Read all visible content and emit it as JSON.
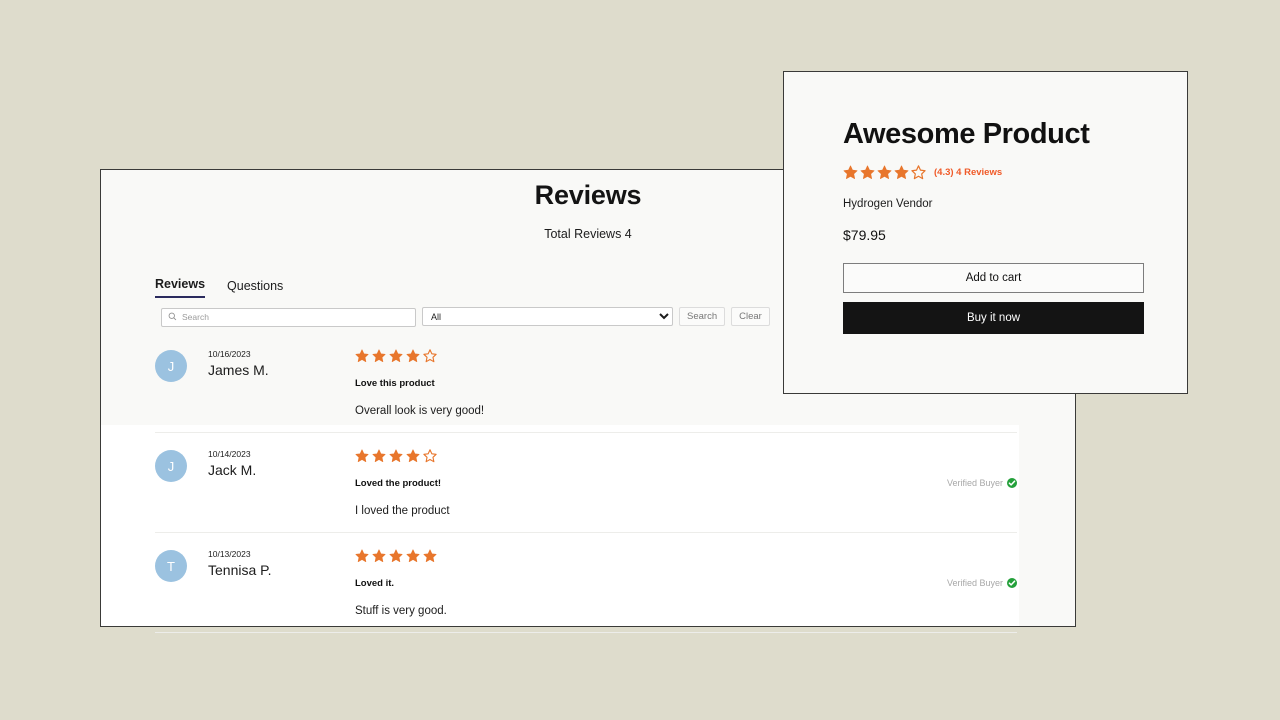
{
  "colors": {
    "page_background": "#dedccc",
    "panel_background": "#f9f9f7",
    "star_orange": "#e8762c",
    "rating_text_orange": "#f05a28",
    "avatar_blue": "#9bc2e0",
    "verified_green": "#23a03a",
    "tab_underline": "#2b2b5e",
    "buy_button_background": "#141414"
  },
  "reviews_widget": {
    "title": "Reviews",
    "total_label": "Total Reviews 4",
    "tabs": [
      {
        "label": "Reviews",
        "active": true
      },
      {
        "label": "Questions",
        "active": false
      }
    ],
    "filters": {
      "search_placeholder": "Search",
      "search_value": "",
      "search_icon": "search-icon",
      "select_value": "All",
      "select_options": [
        "All"
      ],
      "search_button": "Search",
      "clear_button": "Clear"
    },
    "reviews": [
      {
        "avatar_initial": "J",
        "date": "10/16/2023",
        "author": "James M.",
        "rating": 4,
        "max_rating": 5,
        "heading": "Love this product",
        "body": "Overall look is very good!",
        "verified": false,
        "verified_label": "Verified Buyer"
      },
      {
        "avatar_initial": "J",
        "date": "10/14/2023",
        "author": "Jack M.",
        "rating": 4,
        "max_rating": 5,
        "heading": "Loved the product!",
        "body": "I loved the product",
        "verified": true,
        "verified_label": "Verified Buyer"
      },
      {
        "avatar_initial": "T",
        "date": "10/13/2023",
        "author": "Tennisa P.",
        "rating": 5,
        "max_rating": 5,
        "heading": "Loved it.",
        "body": "Stuff is very good.",
        "verified": true,
        "verified_label": "Verified Buyer"
      }
    ]
  },
  "product_card": {
    "title": "Awesome Product",
    "rating": 4,
    "max_rating": 5,
    "rating_text": "(4.3) 4 Reviews",
    "vendor": "Hydrogen Vendor",
    "price": "$79.95",
    "add_to_cart_label": "Add to cart",
    "buy_now_label": "Buy it now"
  }
}
